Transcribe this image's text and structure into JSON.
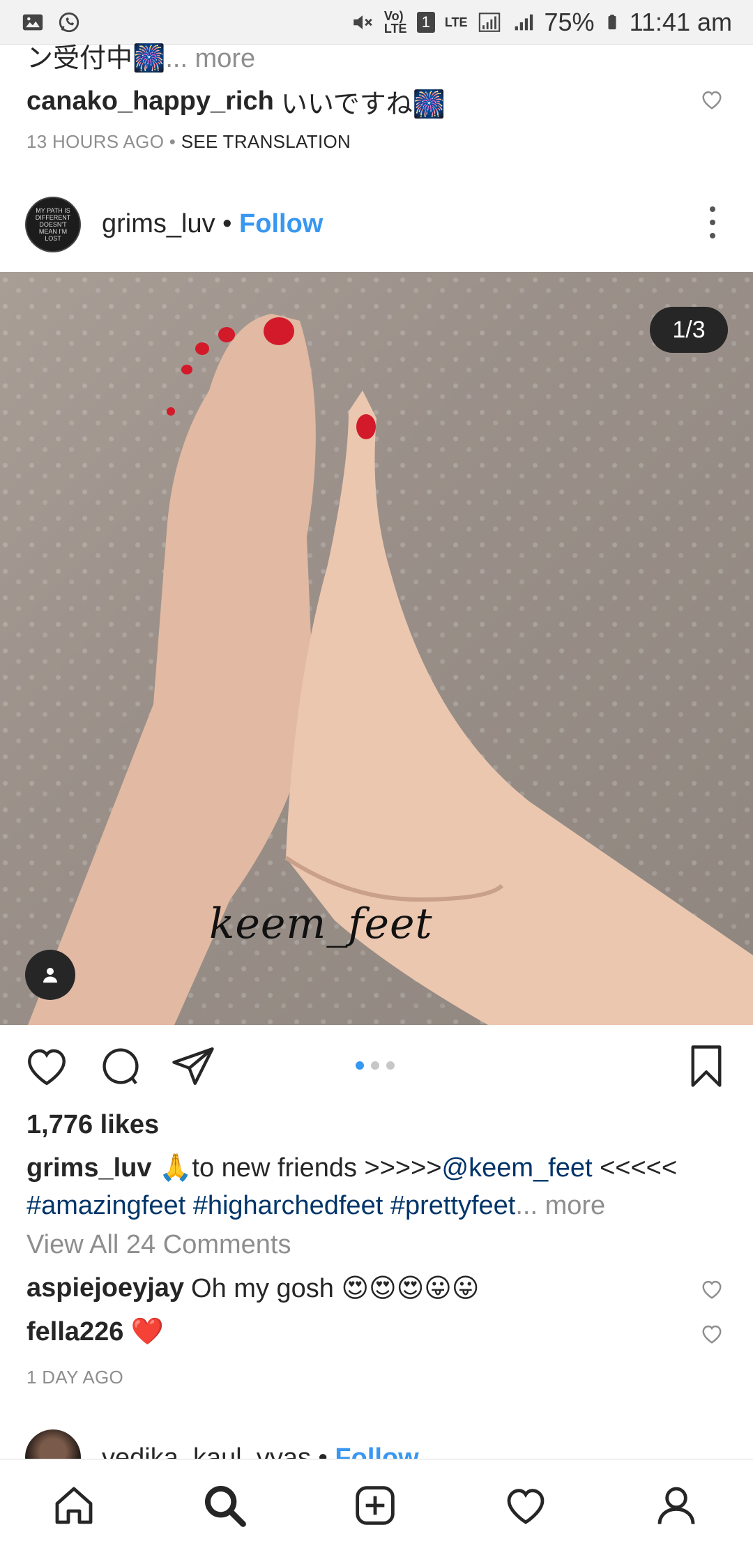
{
  "status_bar": {
    "volte": "Vo)\nLTE",
    "sim": "1",
    "lte": "LTE",
    "battery": "75%",
    "time": "11:41 am"
  },
  "prev_post": {
    "truncated_caption": "ン受付中🎆",
    "more_label": "... more",
    "comment": {
      "user": "canako_happy_rich",
      "text": "いいですね🎆"
    },
    "time": "13 HOURS AGO",
    "separator": "•",
    "see_translation": "SEE TRANSLATION"
  },
  "post": {
    "avatar_text": "MY PATH IS DIFFERENT DOESN'T MEAN I'M LOST",
    "username": "grims_luv",
    "dot": "•",
    "follow_label": "Follow",
    "image": {
      "counter": "1/3",
      "watermark": "keem_feet",
      "slide_index": 1,
      "slide_total": 3
    },
    "likes": "1,776 likes",
    "caption": {
      "user": "grims_luv",
      "emoji": "🙏",
      "text": "to new friends >>>>>",
      "mention": "@keem_feet",
      "after_mention": " <<<<<",
      "hashtags": "#amazingfeet #higharchedfeet #prettyfeet",
      "more": "... more"
    },
    "view_all": "View All 24 Comments",
    "comments": [
      {
        "user": "aspiejoeyjay",
        "text": "Oh my gosh 😍😍😍😛😛"
      },
      {
        "user": "fella226",
        "text": "❤️"
      }
    ],
    "time": "1 DAY AGO"
  },
  "next_post": {
    "username": "vedika_kaul_vyas",
    "dot": "•",
    "follow_label": "Follow"
  },
  "colors": {
    "accent": "#3897f0",
    "mention": "#003569",
    "muted": "#8e8e8e",
    "text": "#262626"
  },
  "icons": {
    "actions": [
      "heart-icon",
      "comment-icon",
      "share-icon",
      "bookmark-icon"
    ],
    "nav": [
      "home-icon",
      "search-icon",
      "add-post-icon",
      "activity-heart-icon",
      "profile-icon"
    ]
  }
}
